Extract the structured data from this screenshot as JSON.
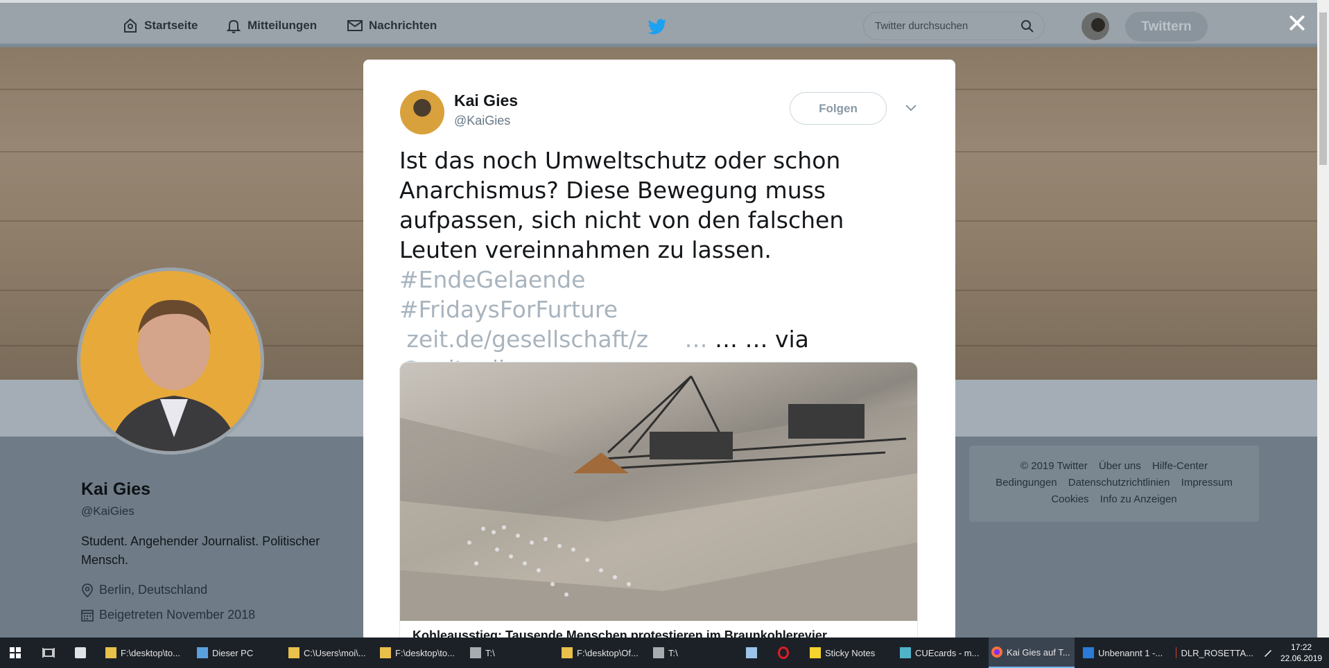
{
  "header": {
    "nav": [
      {
        "label": "Startseite",
        "icon": "home-icon"
      },
      {
        "label": "Mitteilungen",
        "icon": "bell-icon"
      },
      {
        "label": "Nachrichten",
        "icon": "envelope-icon"
      }
    ],
    "search_placeholder": "Twitter durchsuchen",
    "tweet_button": "Twittern",
    "close_glyph": "✕"
  },
  "profile": {
    "name": "Kai Gies",
    "handle": "@KaiGies",
    "bio": "Student. Angehender Journalist. Politischer Mensch.",
    "location": "Berlin, Deutschland",
    "joined": "Beigetreten November 2018"
  },
  "footer": {
    "links": [
      "© 2019 Twitter",
      "Über uns",
      "Hilfe-Center",
      "Bedingungen",
      "Datenschutzrichtlinien",
      "Impressum",
      "Cookies",
      "Info zu Anzeigen"
    ]
  },
  "tweet": {
    "author_name": "Kai Gies",
    "author_handle": "@KaiGies",
    "follow_label": "Folgen",
    "text_main": "Ist das noch Umweltschutz oder schon Anarchismus? Diese Bewegung muss aufpassen, sich nicht von den falschen Leuten vereinnahmen zu lassen. ",
    "hashtag1": "#EndeGelaende",
    "hashtag2": "#FridaysForFurture",
    "link": "zeit.de/gesellschaft/z",
    "link_ellipsis": "…",
    "text_after_link": " … … via ",
    "mention": "@zeitonline",
    "card_title": "Kohleausstieg: Tausende Menschen protestieren im Braunkohlerevier"
  },
  "taskbar": {
    "items": [
      {
        "label": "F:\\desktop\\to...",
        "icon": "folder-icon"
      },
      {
        "label": "Dieser PC",
        "icon": "computer-icon"
      },
      {
        "label": "C:\\Users\\moi\\...",
        "icon": "folder-icon"
      },
      {
        "label": "F:\\desktop\\to...",
        "icon": "folder-icon"
      },
      {
        "label": "T:\\",
        "icon": "drive-icon"
      },
      {
        "label": "F:\\desktop\\Of...",
        "icon": "folder-icon"
      },
      {
        "label": "T:\\",
        "icon": "drive-icon"
      },
      {
        "label": "Sticky Notes",
        "icon": "sticky-notes-icon"
      },
      {
        "label": "CUEcards - m...",
        "icon": "cuecards-icon"
      },
      {
        "label": "Kai Gies auf T...",
        "icon": "firefox-icon"
      },
      {
        "label": "Unbenannt 1 -...",
        "icon": "writer-icon"
      },
      {
        "label": "DLR_ROSETTA...",
        "icon": "pdf-icon"
      }
    ],
    "time": "17:22",
    "date": "22.06.2019"
  }
}
